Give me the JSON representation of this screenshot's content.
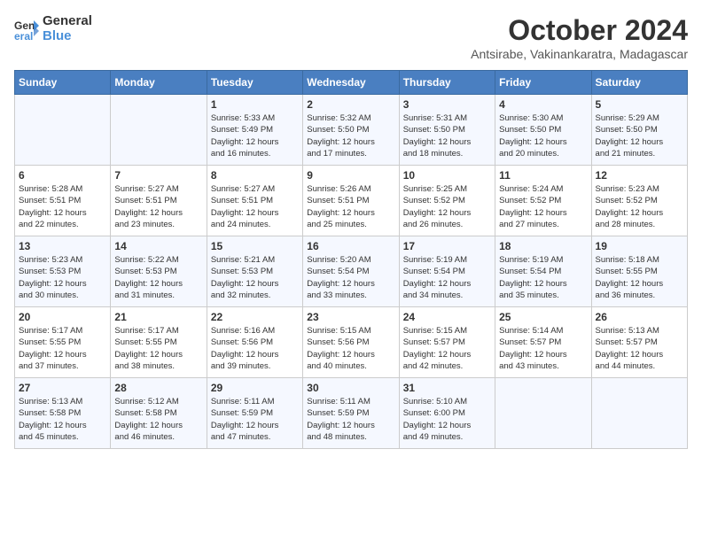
{
  "header": {
    "logo_line1": "General",
    "logo_line2": "Blue",
    "month": "October 2024",
    "location": "Antsirabe, Vakinankaratra, Madagascar"
  },
  "days_of_week": [
    "Sunday",
    "Monday",
    "Tuesday",
    "Wednesday",
    "Thursday",
    "Friday",
    "Saturday"
  ],
  "weeks": [
    [
      {
        "day": "",
        "info": ""
      },
      {
        "day": "",
        "info": ""
      },
      {
        "day": "1",
        "info": "Sunrise: 5:33 AM\nSunset: 5:49 PM\nDaylight: 12 hours\nand 16 minutes."
      },
      {
        "day": "2",
        "info": "Sunrise: 5:32 AM\nSunset: 5:50 PM\nDaylight: 12 hours\nand 17 minutes."
      },
      {
        "day": "3",
        "info": "Sunrise: 5:31 AM\nSunset: 5:50 PM\nDaylight: 12 hours\nand 18 minutes."
      },
      {
        "day": "4",
        "info": "Sunrise: 5:30 AM\nSunset: 5:50 PM\nDaylight: 12 hours\nand 20 minutes."
      },
      {
        "day": "5",
        "info": "Sunrise: 5:29 AM\nSunset: 5:50 PM\nDaylight: 12 hours\nand 21 minutes."
      }
    ],
    [
      {
        "day": "6",
        "info": "Sunrise: 5:28 AM\nSunset: 5:51 PM\nDaylight: 12 hours\nand 22 minutes."
      },
      {
        "day": "7",
        "info": "Sunrise: 5:27 AM\nSunset: 5:51 PM\nDaylight: 12 hours\nand 23 minutes."
      },
      {
        "day": "8",
        "info": "Sunrise: 5:27 AM\nSunset: 5:51 PM\nDaylight: 12 hours\nand 24 minutes."
      },
      {
        "day": "9",
        "info": "Sunrise: 5:26 AM\nSunset: 5:51 PM\nDaylight: 12 hours\nand 25 minutes."
      },
      {
        "day": "10",
        "info": "Sunrise: 5:25 AM\nSunset: 5:52 PM\nDaylight: 12 hours\nand 26 minutes."
      },
      {
        "day": "11",
        "info": "Sunrise: 5:24 AM\nSunset: 5:52 PM\nDaylight: 12 hours\nand 27 minutes."
      },
      {
        "day": "12",
        "info": "Sunrise: 5:23 AM\nSunset: 5:52 PM\nDaylight: 12 hours\nand 28 minutes."
      }
    ],
    [
      {
        "day": "13",
        "info": "Sunrise: 5:23 AM\nSunset: 5:53 PM\nDaylight: 12 hours\nand 30 minutes."
      },
      {
        "day": "14",
        "info": "Sunrise: 5:22 AM\nSunset: 5:53 PM\nDaylight: 12 hours\nand 31 minutes."
      },
      {
        "day": "15",
        "info": "Sunrise: 5:21 AM\nSunset: 5:53 PM\nDaylight: 12 hours\nand 32 minutes."
      },
      {
        "day": "16",
        "info": "Sunrise: 5:20 AM\nSunset: 5:54 PM\nDaylight: 12 hours\nand 33 minutes."
      },
      {
        "day": "17",
        "info": "Sunrise: 5:19 AM\nSunset: 5:54 PM\nDaylight: 12 hours\nand 34 minutes."
      },
      {
        "day": "18",
        "info": "Sunrise: 5:19 AM\nSunset: 5:54 PM\nDaylight: 12 hours\nand 35 minutes."
      },
      {
        "day": "19",
        "info": "Sunrise: 5:18 AM\nSunset: 5:55 PM\nDaylight: 12 hours\nand 36 minutes."
      }
    ],
    [
      {
        "day": "20",
        "info": "Sunrise: 5:17 AM\nSunset: 5:55 PM\nDaylight: 12 hours\nand 37 minutes."
      },
      {
        "day": "21",
        "info": "Sunrise: 5:17 AM\nSunset: 5:55 PM\nDaylight: 12 hours\nand 38 minutes."
      },
      {
        "day": "22",
        "info": "Sunrise: 5:16 AM\nSunset: 5:56 PM\nDaylight: 12 hours\nand 39 minutes."
      },
      {
        "day": "23",
        "info": "Sunrise: 5:15 AM\nSunset: 5:56 PM\nDaylight: 12 hours\nand 40 minutes."
      },
      {
        "day": "24",
        "info": "Sunrise: 5:15 AM\nSunset: 5:57 PM\nDaylight: 12 hours\nand 42 minutes."
      },
      {
        "day": "25",
        "info": "Sunrise: 5:14 AM\nSunset: 5:57 PM\nDaylight: 12 hours\nand 43 minutes."
      },
      {
        "day": "26",
        "info": "Sunrise: 5:13 AM\nSunset: 5:57 PM\nDaylight: 12 hours\nand 44 minutes."
      }
    ],
    [
      {
        "day": "27",
        "info": "Sunrise: 5:13 AM\nSunset: 5:58 PM\nDaylight: 12 hours\nand 45 minutes."
      },
      {
        "day": "28",
        "info": "Sunrise: 5:12 AM\nSunset: 5:58 PM\nDaylight: 12 hours\nand 46 minutes."
      },
      {
        "day": "29",
        "info": "Sunrise: 5:11 AM\nSunset: 5:59 PM\nDaylight: 12 hours\nand 47 minutes."
      },
      {
        "day": "30",
        "info": "Sunrise: 5:11 AM\nSunset: 5:59 PM\nDaylight: 12 hours\nand 48 minutes."
      },
      {
        "day": "31",
        "info": "Sunrise: 5:10 AM\nSunset: 6:00 PM\nDaylight: 12 hours\nand 49 minutes."
      },
      {
        "day": "",
        "info": ""
      },
      {
        "day": "",
        "info": ""
      }
    ]
  ]
}
